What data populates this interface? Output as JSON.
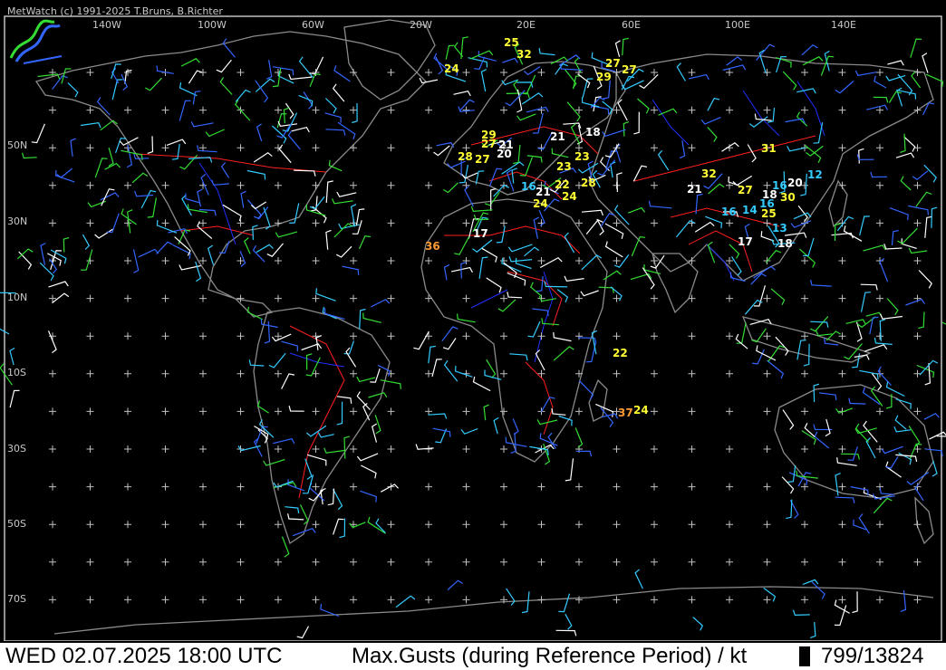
{
  "header": {
    "copyright": "MetWatch  (c) 1991-2025 T.Bruns, B.Richter"
  },
  "map": {
    "longitude_labels": [
      "140W",
      "100W",
      "60W",
      "20W",
      "20E",
      "60E",
      "100E",
      "140E"
    ],
    "latitude_labels": [
      "50N",
      "30N",
      "10N",
      "10S",
      "30S",
      "50S",
      "70S"
    ],
    "colors": {
      "background": "#000000",
      "coastline": "#8a8a8a",
      "border": "#ff2020",
      "river": "#2030ff",
      "grid_cross": "#bfbfbf"
    },
    "barb_colors": [
      "#ffffff",
      "#3366ff",
      "#33dd33",
      "#33ccff",
      "#ffff33",
      "#ff9933"
    ],
    "gust_labels": [
      {
        "text": "25",
        "color": "#ffff33"
      },
      {
        "text": "32",
        "color": "#ffff33"
      },
      {
        "text": "24",
        "color": "#ffff33"
      },
      {
        "text": "27",
        "color": "#ffff33"
      },
      {
        "text": "29",
        "color": "#ffff33"
      },
      {
        "text": "27",
        "color": "#ffff33"
      },
      {
        "text": "18",
        "color": "#ffffff"
      },
      {
        "text": "21",
        "color": "#ffffff"
      },
      {
        "text": "29",
        "color": "#ffff33"
      },
      {
        "text": "27",
        "color": "#ffff33"
      },
      {
        "text": "21",
        "color": "#ffffff"
      },
      {
        "text": "28",
        "color": "#ffff33"
      },
      {
        "text": "27",
        "color": "#ffff33"
      },
      {
        "text": "20",
        "color": "#ffffff"
      },
      {
        "text": "23",
        "color": "#ffff33"
      },
      {
        "text": "23",
        "color": "#ffff33"
      },
      {
        "text": "31",
        "color": "#ffff33"
      },
      {
        "text": "32",
        "color": "#ffff33"
      },
      {
        "text": "20",
        "color": "#ffffff"
      },
      {
        "text": "12",
        "color": "#33ccff"
      },
      {
        "text": "16",
        "color": "#33ccff"
      },
      {
        "text": "21",
        "color": "#ffffff"
      },
      {
        "text": "22",
        "color": "#ffff33"
      },
      {
        "text": "28",
        "color": "#ffff33"
      },
      {
        "text": "21",
        "color": "#ffffff"
      },
      {
        "text": "27",
        "color": "#ffff33"
      },
      {
        "text": "18",
        "color": "#ffffff"
      },
      {
        "text": "30",
        "color": "#ffff33"
      },
      {
        "text": "16",
        "color": "#33ccff"
      },
      {
        "text": "24",
        "color": "#ffff33"
      },
      {
        "text": "24",
        "color": "#ffff33"
      },
      {
        "text": "16",
        "color": "#33ccff"
      },
      {
        "text": "14",
        "color": "#33ccff"
      },
      {
        "text": "16",
        "color": "#33ccff"
      },
      {
        "text": "25",
        "color": "#ffff33"
      },
      {
        "text": "13",
        "color": "#33ccff"
      },
      {
        "text": "17",
        "color": "#ffffff"
      },
      {
        "text": "17",
        "color": "#ffffff"
      },
      {
        "text": "18",
        "color": "#ffffff"
      },
      {
        "text": "36",
        "color": "#ff9933"
      },
      {
        "text": "22",
        "color": "#ffff33"
      },
      {
        "text": "37",
        "color": "#ff9933"
      },
      {
        "text": "24",
        "color": "#ffff33"
      }
    ]
  },
  "status": {
    "datetime": "WED 02.07.2025 18:00 UTC",
    "title": "Max.Gusts (during Reference Period) / kt",
    "count": "799/13824"
  }
}
